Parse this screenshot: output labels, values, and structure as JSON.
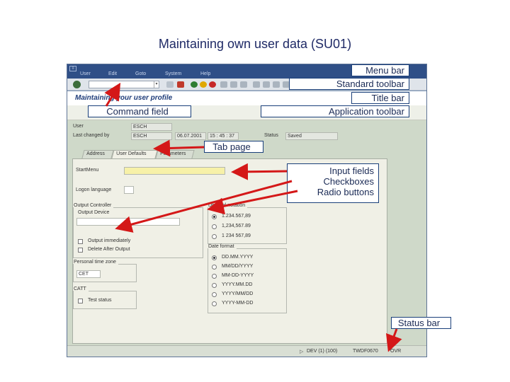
{
  "slide_title": "Maintaining own user data (SU01)",
  "menubar": {
    "items": [
      "User",
      "Edit",
      "Goto",
      "System",
      "Help"
    ]
  },
  "titlebar": {
    "title": "Maintaining your user profile"
  },
  "header_fields": {
    "user_label": "User",
    "user_value": "ESCH",
    "changed_by_label": "Last changed by",
    "changed_by_value": "ESCH",
    "date_value": "06.07.2001",
    "time_value": "15 : 45 : 37",
    "status_label": "Status",
    "status_value": "Saved"
  },
  "tabs": [
    "Address",
    "User Defaults",
    "Parameters"
  ],
  "form": {
    "start_menu_label": "StartMenu",
    "logon_language_label": "Logon language",
    "output_controller": {
      "title": "Output Controller",
      "output_device_label": "Output Device",
      "options": [
        "Output immediately",
        "Delete After Output"
      ]
    },
    "personal_time_zone": {
      "title": "Personal time zone",
      "value": "CET"
    },
    "catt": {
      "title": "CATT",
      "options": [
        "Test status"
      ]
    },
    "decimal_notation": {
      "title": "Decimal notation",
      "options": [
        "1.234.567,89",
        "1,234,567.89",
        "1 234 567,89"
      ],
      "selected": 0
    },
    "date_format": {
      "title": "Date format",
      "options": [
        "DD.MM.YYYY",
        "MM/DD/YYYY",
        "MM-DD-YYYY",
        "YYYY.MM.DD",
        "YYYY/MM/DD",
        "YYYY-MM-DD"
      ],
      "selected": 0
    }
  },
  "statusbar": {
    "system": "DEV (1) (100)",
    "host": "TWDF0670",
    "mode": "OVR"
  },
  "callouts": {
    "menu_bar": "Menu bar",
    "standard_toolbar": "Standard toolbar",
    "title_bar": "Title bar",
    "command_field": "Command field",
    "application_toolbar": "Application toolbar",
    "tab_page": "Tab page",
    "input_fields": "Input fields",
    "checkboxes": "Checkboxes",
    "radio_buttons": "Radio buttons",
    "status_bar": "Status bar"
  },
  "colors": {
    "annotation_arrow": "#d41818",
    "menubar_bg": "#2f4f87",
    "screen_bg": "#7d97b8",
    "callout_border": "#1a3f7a"
  }
}
